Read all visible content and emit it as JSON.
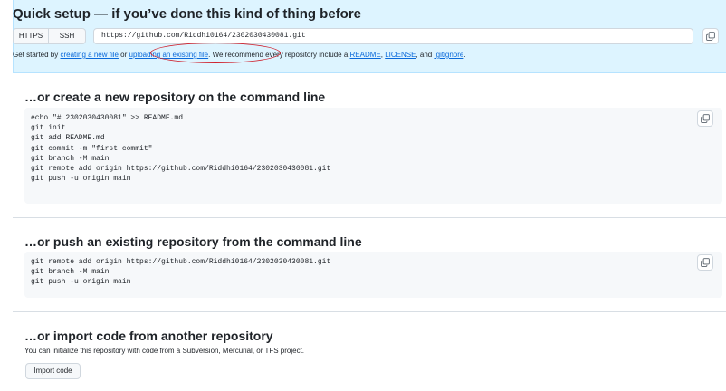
{
  "quick_setup": {
    "title": "Quick setup — if you’ve done this kind of thing before",
    "protocols": [
      "HTTPS",
      "SSH"
    ],
    "clone_url": "https://github.com/Riddhi0164/2302030430081.git",
    "intro": {
      "t1": "Get started by ",
      "link_new": "creating a new file",
      "t2": " or ",
      "link_upload": "uploading an existing file",
      "t3": ". We recommend every repository include a ",
      "link_readme": "README",
      "t4": ", ",
      "link_license": "LICENSE",
      "t5": ", and ",
      "link_gitignore": ".gitignore",
      "t6": "."
    }
  },
  "new_repo": {
    "title": "…or create a new repository on the command line",
    "code": "echo \"# 2302030430081\" >> README.md\ngit init\ngit add README.md\ngit commit -m \"first commit\"\ngit branch -M main\ngit remote add origin https://github.com/Riddhi0164/2302030430081.git\ngit push -u origin main"
  },
  "push_existing": {
    "title": "…or push an existing repository from the command line",
    "code": "git remote add origin https://github.com/Riddhi0164/2302030430081.git\ngit branch -M main\ngit push -u origin main"
  },
  "import_repo": {
    "title": "…or import code from another repository",
    "description": "You can initialize this repository with code from a Subversion, Mercurial, or TFS project.",
    "button": "Import code"
  },
  "annotation_color": "#cf222e",
  "icons": {
    "copy": "copy-icon"
  }
}
